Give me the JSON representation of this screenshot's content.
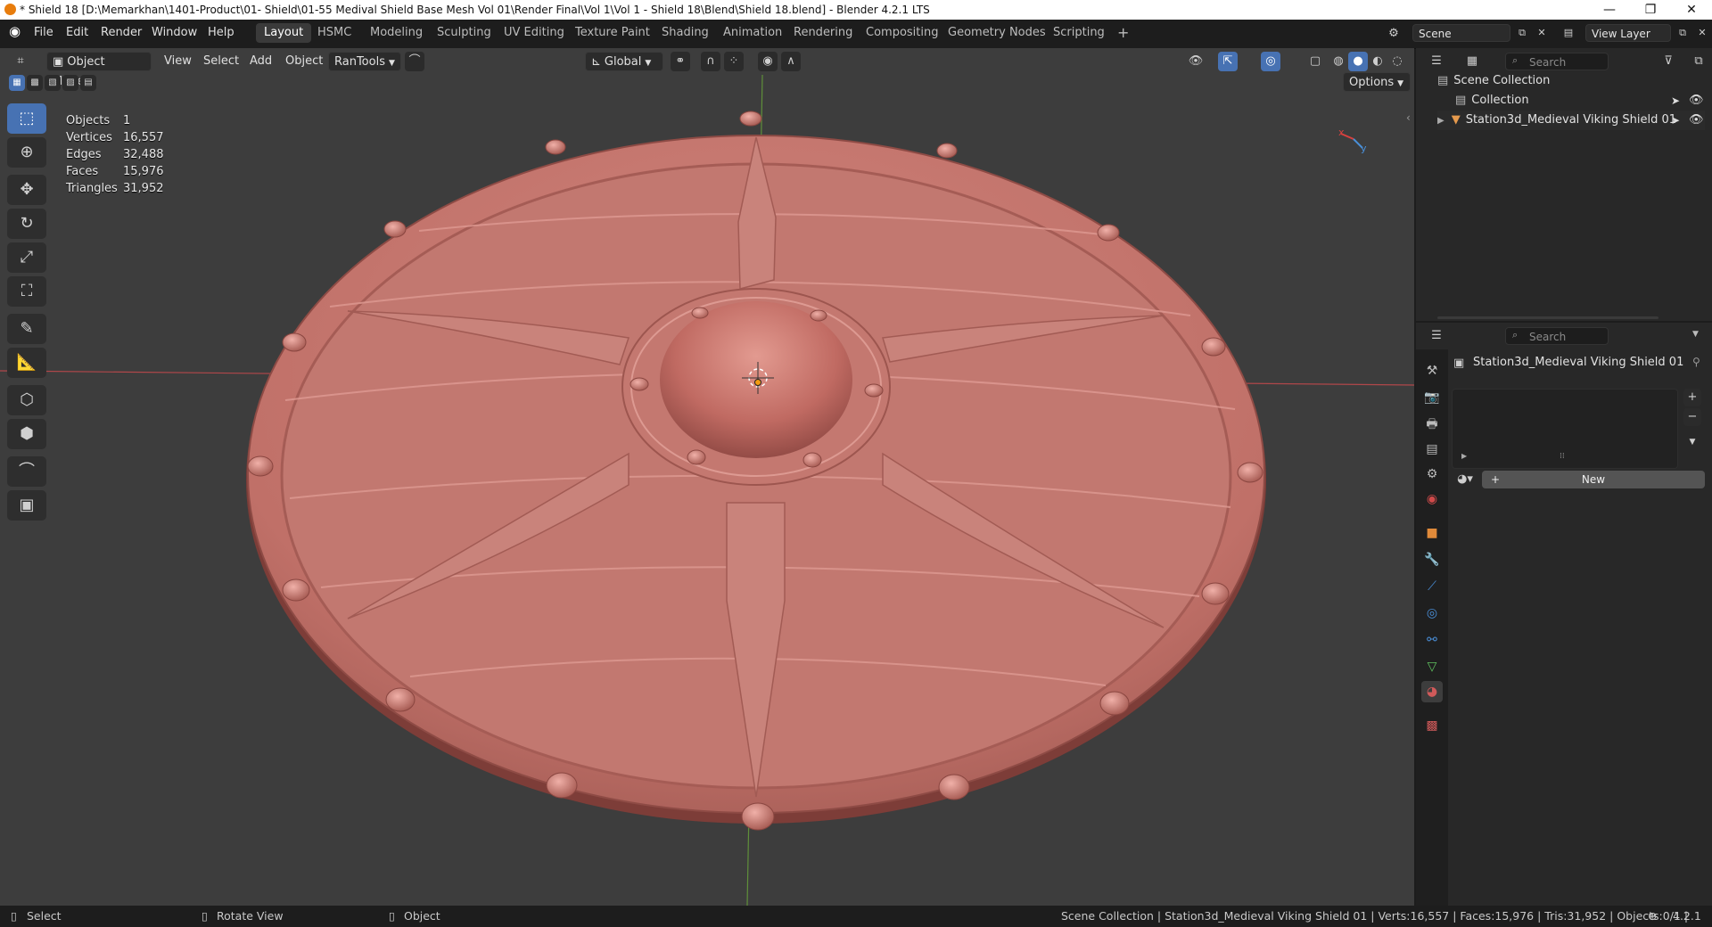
{
  "window": {
    "title": "* Shield 18 [D:\\Memarkhan\\1401-Product\\01- Shield\\01-55 Medival Shield Base Mesh Vol 01\\Render Final\\Vol 1\\Vol 1 - Shield 18\\Blend\\Shield 18.blend] - Blender 4.2.1 LTS",
    "minimize": "—",
    "restore": "❐",
    "close": "✕"
  },
  "menu": {
    "file": "File",
    "edit": "Edit",
    "render": "Render",
    "window": "Window",
    "help": "Help"
  },
  "workspaces": [
    "Layout",
    "HSMC",
    "Modeling",
    "Sculpting",
    "UV Editing",
    "Texture Paint",
    "Shading",
    "Animation",
    "Rendering",
    "Compositing",
    "Geometry Nodes",
    "Scripting",
    "+"
  ],
  "active_workspace": "Layout",
  "scene": {
    "name": "Scene",
    "view_layer": "View Layer"
  },
  "viewport_header": {
    "mode": "Object Mode",
    "view": "View",
    "select": "Select",
    "add": "Add",
    "object": "Object",
    "addon": "RanTools",
    "orientation": "Global",
    "options": "Options"
  },
  "stats": [
    {
      "label": "Objects",
      "value": "1"
    },
    {
      "label": "Vertices",
      "value": "16,557"
    },
    {
      "label": "Edges",
      "value": "32,488"
    },
    {
      "label": "Faces",
      "value": "15,976"
    },
    {
      "label": "Triangles",
      "value": "31,952"
    }
  ],
  "outliner": {
    "search_placeholder": "Search",
    "scene_collection": "Scene Collection",
    "collection": "Collection",
    "object": "Station3d_Medieval Viking Shield 01"
  },
  "properties": {
    "search_placeholder": "Search",
    "object_name": "Station3d_Medieval Viking Shield 01",
    "new_label": "New"
  },
  "statusbar": {
    "select": "Select",
    "rotate": "Rotate View",
    "object": "Object",
    "info": "Scene Collection | Station3d_Medieval Viking Shield 01 | Verts:16,557 | Faces:15,976 | Tris:31,952 | Objects:0/1 |",
    "version": "4.2.1"
  },
  "colors": {
    "accent": "#4772b3",
    "shield": "#c67a72",
    "viewport_bg": "#3d3d3d"
  }
}
